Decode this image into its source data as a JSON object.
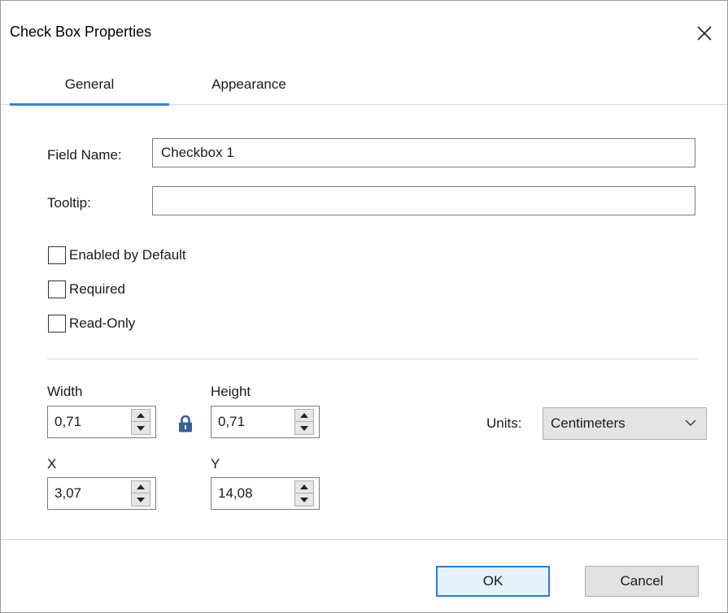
{
  "window": {
    "title": "Check Box Properties"
  },
  "tabs": [
    {
      "label": "General",
      "active": true
    },
    {
      "label": "Appearance",
      "active": false
    }
  ],
  "general": {
    "field_name_label": "Field Name:",
    "field_name_value": "Checkbox 1",
    "tooltip_label": "Tooltip:",
    "tooltip_value": "",
    "checkboxes": [
      {
        "label": "Enabled by Default",
        "checked": false
      },
      {
        "label": "Required",
        "checked": false
      },
      {
        "label": "Read-Only",
        "checked": false
      }
    ],
    "size": {
      "width_label": "Width",
      "width_value": "0,71",
      "height_label": "Height",
      "height_value": "0,71",
      "x_label": "X",
      "x_value": "3,07",
      "y_label": "Y",
      "y_value": "14,08",
      "lock_icon": "lock-icon"
    },
    "units": {
      "label": "Units:",
      "selected": "Centimeters"
    }
  },
  "buttons": {
    "ok": "OK",
    "cancel": "Cancel"
  },
  "colors": {
    "accent": "#3b7fd0",
    "ok_border": "#2a7fd4",
    "lock": "#3a5f98"
  }
}
